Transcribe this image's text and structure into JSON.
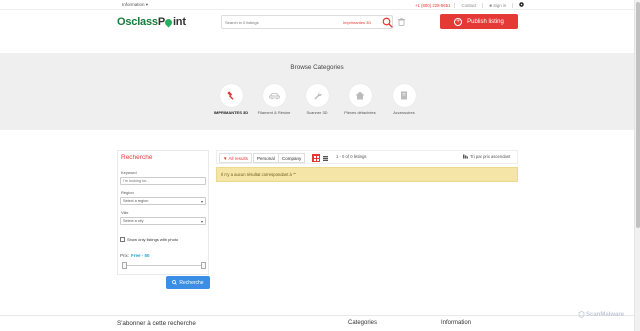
{
  "topbar": {
    "information": "Information",
    "phone": "+1 (800) 228-5651",
    "contact": "Contact",
    "sign_in": "Sign in"
  },
  "header": {
    "logo_part1": "Osclass",
    "logo_part2": "P",
    "logo_part3": "int",
    "search_placeholder": "Search in 0 listings",
    "search_category": "Imprimantes 3D",
    "publish_label": "Publish listing"
  },
  "browse": {
    "title": "Browse Categories",
    "categories": [
      {
        "label": "IMPRIMANTES 3D",
        "icon": "hammer-icon"
      },
      {
        "label": "Filament & Résine",
        "icon": "car-icon"
      },
      {
        "label": "Scanner 3D",
        "icon": "wrench-icon"
      },
      {
        "label": "Pièces détachées",
        "icon": "house-icon"
      },
      {
        "label": "Accessoires",
        "icon": "book-icon"
      }
    ]
  },
  "sidebar": {
    "title": "Recherche",
    "keyword_label": "Keyword",
    "keyword_placeholder": "I'm looking for...",
    "region_label": "Région",
    "region_value": "Select a region",
    "city_label": "Ville",
    "city_value": "Select a city",
    "photo_label": "Show only listings with photo",
    "price_label": "Prix:",
    "price_value": "Free - 50",
    "search_button": "Recherche"
  },
  "results": {
    "tabs": [
      "All results",
      "Personal",
      "Company"
    ],
    "count": "1 - 0 of 0 listings",
    "sort": "Tri par prix ascendant",
    "no_results": "Il n'y a aucun résultat correspondant à \"\""
  },
  "footer": {
    "subscribe": "S'abonner à cette recherche",
    "categories": "Categories",
    "information": "Information"
  },
  "watermark": "ScanMalware",
  "colors": {
    "accent": "#e53935",
    "brand_green": "#1a7a3a",
    "link_blue": "#3a8ee6",
    "band": "#efefef",
    "alert": "#f5e6a8"
  }
}
